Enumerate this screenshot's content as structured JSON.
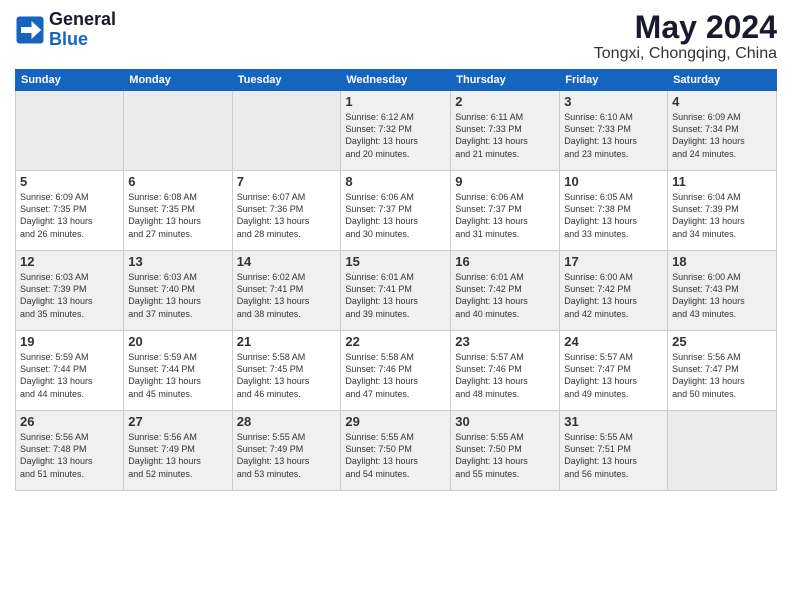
{
  "logo": {
    "line1": "General",
    "line2": "Blue"
  },
  "title": "May 2024",
  "subtitle": "Tongxi, Chongqing, China",
  "days_of_week": [
    "Sunday",
    "Monday",
    "Tuesday",
    "Wednesday",
    "Thursday",
    "Friday",
    "Saturday"
  ],
  "weeks": [
    [
      {
        "day": "",
        "info": ""
      },
      {
        "day": "",
        "info": ""
      },
      {
        "day": "",
        "info": ""
      },
      {
        "day": "1",
        "info": "Sunrise: 6:12 AM\nSunset: 7:32 PM\nDaylight: 13 hours\nand 20 minutes."
      },
      {
        "day": "2",
        "info": "Sunrise: 6:11 AM\nSunset: 7:33 PM\nDaylight: 13 hours\nand 21 minutes."
      },
      {
        "day": "3",
        "info": "Sunrise: 6:10 AM\nSunset: 7:33 PM\nDaylight: 13 hours\nand 23 minutes."
      },
      {
        "day": "4",
        "info": "Sunrise: 6:09 AM\nSunset: 7:34 PM\nDaylight: 13 hours\nand 24 minutes."
      }
    ],
    [
      {
        "day": "5",
        "info": "Sunrise: 6:09 AM\nSunset: 7:35 PM\nDaylight: 13 hours\nand 26 minutes."
      },
      {
        "day": "6",
        "info": "Sunrise: 6:08 AM\nSunset: 7:35 PM\nDaylight: 13 hours\nand 27 minutes."
      },
      {
        "day": "7",
        "info": "Sunrise: 6:07 AM\nSunset: 7:36 PM\nDaylight: 13 hours\nand 28 minutes."
      },
      {
        "day": "8",
        "info": "Sunrise: 6:06 AM\nSunset: 7:37 PM\nDaylight: 13 hours\nand 30 minutes."
      },
      {
        "day": "9",
        "info": "Sunrise: 6:06 AM\nSunset: 7:37 PM\nDaylight: 13 hours\nand 31 minutes."
      },
      {
        "day": "10",
        "info": "Sunrise: 6:05 AM\nSunset: 7:38 PM\nDaylight: 13 hours\nand 33 minutes."
      },
      {
        "day": "11",
        "info": "Sunrise: 6:04 AM\nSunset: 7:39 PM\nDaylight: 13 hours\nand 34 minutes."
      }
    ],
    [
      {
        "day": "12",
        "info": "Sunrise: 6:03 AM\nSunset: 7:39 PM\nDaylight: 13 hours\nand 35 minutes."
      },
      {
        "day": "13",
        "info": "Sunrise: 6:03 AM\nSunset: 7:40 PM\nDaylight: 13 hours\nand 37 minutes."
      },
      {
        "day": "14",
        "info": "Sunrise: 6:02 AM\nSunset: 7:41 PM\nDaylight: 13 hours\nand 38 minutes."
      },
      {
        "day": "15",
        "info": "Sunrise: 6:01 AM\nSunset: 7:41 PM\nDaylight: 13 hours\nand 39 minutes."
      },
      {
        "day": "16",
        "info": "Sunrise: 6:01 AM\nSunset: 7:42 PM\nDaylight: 13 hours\nand 40 minutes."
      },
      {
        "day": "17",
        "info": "Sunrise: 6:00 AM\nSunset: 7:42 PM\nDaylight: 13 hours\nand 42 minutes."
      },
      {
        "day": "18",
        "info": "Sunrise: 6:00 AM\nSunset: 7:43 PM\nDaylight: 13 hours\nand 43 minutes."
      }
    ],
    [
      {
        "day": "19",
        "info": "Sunrise: 5:59 AM\nSunset: 7:44 PM\nDaylight: 13 hours\nand 44 minutes."
      },
      {
        "day": "20",
        "info": "Sunrise: 5:59 AM\nSunset: 7:44 PM\nDaylight: 13 hours\nand 45 minutes."
      },
      {
        "day": "21",
        "info": "Sunrise: 5:58 AM\nSunset: 7:45 PM\nDaylight: 13 hours\nand 46 minutes."
      },
      {
        "day": "22",
        "info": "Sunrise: 5:58 AM\nSunset: 7:46 PM\nDaylight: 13 hours\nand 47 minutes."
      },
      {
        "day": "23",
        "info": "Sunrise: 5:57 AM\nSunset: 7:46 PM\nDaylight: 13 hours\nand 48 minutes."
      },
      {
        "day": "24",
        "info": "Sunrise: 5:57 AM\nSunset: 7:47 PM\nDaylight: 13 hours\nand 49 minutes."
      },
      {
        "day": "25",
        "info": "Sunrise: 5:56 AM\nSunset: 7:47 PM\nDaylight: 13 hours\nand 50 minutes."
      }
    ],
    [
      {
        "day": "26",
        "info": "Sunrise: 5:56 AM\nSunset: 7:48 PM\nDaylight: 13 hours\nand 51 minutes."
      },
      {
        "day": "27",
        "info": "Sunrise: 5:56 AM\nSunset: 7:49 PM\nDaylight: 13 hours\nand 52 minutes."
      },
      {
        "day": "28",
        "info": "Sunrise: 5:55 AM\nSunset: 7:49 PM\nDaylight: 13 hours\nand 53 minutes."
      },
      {
        "day": "29",
        "info": "Sunrise: 5:55 AM\nSunset: 7:50 PM\nDaylight: 13 hours\nand 54 minutes."
      },
      {
        "day": "30",
        "info": "Sunrise: 5:55 AM\nSunset: 7:50 PM\nDaylight: 13 hours\nand 55 minutes."
      },
      {
        "day": "31",
        "info": "Sunrise: 5:55 AM\nSunset: 7:51 PM\nDaylight: 13 hours\nand 56 minutes."
      },
      {
        "day": "",
        "info": ""
      }
    ]
  ]
}
